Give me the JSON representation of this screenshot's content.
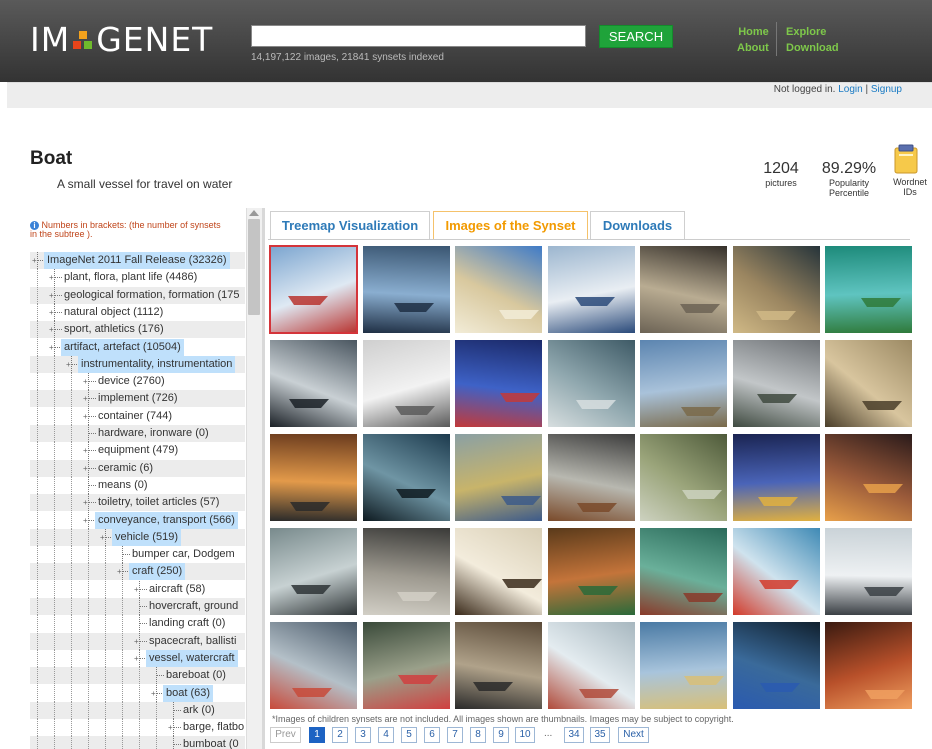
{
  "header": {
    "logo_text_left": "IM",
    "logo_text_right": "GENET",
    "search_button": "SEARCH",
    "index_info": "14,197,122 images, 21841 synsets indexed",
    "nav_left": [
      "Home",
      "About"
    ],
    "nav_right": [
      "Explore",
      "Download"
    ],
    "login_prefix": "Not logged in.",
    "login_link": "Login",
    "login_sep": "|",
    "signup_link": "Signup"
  },
  "synset": {
    "title": "Boat",
    "gloss": "A small vessel for travel on water",
    "pictures_count": "1204",
    "pictures_label": "pictures",
    "popularity_value": "89.29%",
    "popularity_label_1": "Popularity",
    "popularity_label_2": "Percentile",
    "wordnet_label_1": "Wordnet",
    "wordnet_label_2": "IDs"
  },
  "tree": {
    "note_line1": "Numbers in brackets: (the number of synsets",
    "note_line2": "in the subtree ).",
    "items": [
      {
        "label": "ImageNet 2011 Fall Release (32326)",
        "depth": 0,
        "selected": true,
        "expandable": true
      },
      {
        "label": "plant, flora, plant life (4486)",
        "depth": 1,
        "selected": false,
        "expandable": true
      },
      {
        "label": "geological formation, formation (175",
        "depth": 1,
        "selected": false,
        "expandable": true
      },
      {
        "label": "natural object (1112)",
        "depth": 1,
        "selected": false,
        "expandable": true
      },
      {
        "label": "sport, athletics (176)",
        "depth": 1,
        "selected": false,
        "expandable": true
      },
      {
        "label": "artifact, artefact (10504)",
        "depth": 1,
        "selected": true,
        "expandable": true
      },
      {
        "label": "instrumentality, instrumentation",
        "depth": 2,
        "selected": true,
        "expandable": true
      },
      {
        "label": "device (2760)",
        "depth": 3,
        "selected": false,
        "expandable": true
      },
      {
        "label": "implement (726)",
        "depth": 3,
        "selected": false,
        "expandable": true
      },
      {
        "label": "container (744)",
        "depth": 3,
        "selected": false,
        "expandable": true
      },
      {
        "label": "hardware, ironware (0)",
        "depth": 3,
        "selected": false,
        "expandable": false
      },
      {
        "label": "equipment (479)",
        "depth": 3,
        "selected": false,
        "expandable": true
      },
      {
        "label": "ceramic (6)",
        "depth": 3,
        "selected": false,
        "expandable": true
      },
      {
        "label": "means (0)",
        "depth": 3,
        "selected": false,
        "expandable": false
      },
      {
        "label": "toiletry, toilet articles (57)",
        "depth": 3,
        "selected": false,
        "expandable": true
      },
      {
        "label": "conveyance, transport (566)",
        "depth": 3,
        "selected": true,
        "expandable": true
      },
      {
        "label": "vehicle (519)",
        "depth": 4,
        "selected": true,
        "expandable": true
      },
      {
        "label": "bumper car, Dodgem",
        "depth": 5,
        "selected": false,
        "expandable": false
      },
      {
        "label": "craft (250)",
        "depth": 5,
        "selected": true,
        "expandable": true
      },
      {
        "label": "aircraft (58)",
        "depth": 6,
        "selected": false,
        "expandable": true
      },
      {
        "label": "hovercraft, ground",
        "depth": 6,
        "selected": false,
        "expandable": false
      },
      {
        "label": "landing craft (0)",
        "depth": 6,
        "selected": false,
        "expandable": false
      },
      {
        "label": "spacecraft, ballisti",
        "depth": 6,
        "selected": false,
        "expandable": true
      },
      {
        "label": "vessel, watercraft",
        "depth": 6,
        "selected": true,
        "expandable": true
      },
      {
        "label": "bareboat (0)",
        "depth": 7,
        "selected": false,
        "expandable": false
      },
      {
        "label": "boat (63)",
        "depth": 7,
        "selected": true,
        "expandable": true
      },
      {
        "label": "ark (0)",
        "depth": 8,
        "selected": false,
        "expandable": false
      },
      {
        "label": "barge, flatbo",
        "depth": 8,
        "selected": false,
        "expandable": true
      },
      {
        "label": "bumboat (0",
        "depth": 8,
        "selected": false,
        "expandable": false
      }
    ]
  },
  "tabs": [
    {
      "label": "Treemap Visualization",
      "active": false
    },
    {
      "label": "Images of the Synset",
      "active": true
    },
    {
      "label": "Downloads",
      "active": false
    }
  ],
  "images": {
    "count_shown": 35,
    "palettes": [
      [
        "#7aa4cf",
        "#dfe9f3",
        "#b8322e"
      ],
      [
        "#3a5672",
        "#8aaed0",
        "#1f2f44"
      ],
      [
        "#3f7bc7",
        "#d8c89e",
        "#f2ecd7"
      ],
      [
        "#9cb6cf",
        "#e9eef3",
        "#2a4a7a"
      ],
      [
        "#35302a",
        "#b9ac92",
        "#6c6355"
      ],
      [
        "#26343a",
        "#9a8560",
        "#d0b986"
      ],
      [
        "#1d8a7a",
        "#5fc4c0",
        "#2f7a3a"
      ],
      [
        "#4a5660",
        "#c9d0d4",
        "#1a2026"
      ],
      [
        "#cfcfcf",
        "#f2f2f2",
        "#5a5a5a"
      ],
      [
        "#1b2a6a",
        "#3e62c7",
        "#c23a3a"
      ],
      [
        "#3e5a66",
        "#8fa7ae",
        "#d7dedf"
      ],
      [
        "#5c85b0",
        "#a9c2da",
        "#7a6a4a"
      ],
      [
        "#6e7276",
        "#c2c6c8",
        "#3f4a40"
      ],
      [
        "#9c8a64",
        "#d8c59e",
        "#4a3e2a"
      ],
      [
        "#6a3b1e",
        "#e39a4a",
        "#2a2a2a"
      ],
      [
        "#1d3b4e",
        "#6f95a4",
        "#0e1a20"
      ],
      [
        "#8aa0a4",
        "#c8b46a",
        "#3c5a8a"
      ],
      [
        "#3c3c3c",
        "#b8b8b0",
        "#7a4a2a"
      ],
      [
        "#4e5a3a",
        "#9aa47a",
        "#cdd2c0"
      ],
      [
        "#1a2452",
        "#4a64b8",
        "#e0b040"
      ],
      [
        "#2a1a1a",
        "#9a5a3a",
        "#e8a04a"
      ],
      [
        "#788a8c",
        "#c7d1d2",
        "#2e3436"
      ],
      [
        "#3a3a38",
        "#9e9a90",
        "#d2cfc6"
      ],
      [
        "#d9cfb6",
        "#f3ecdc",
        "#3a2a1a"
      ],
      [
        "#5a3a1a",
        "#c4743a",
        "#2a6a3a"
      ],
      [
        "#2a6a5a",
        "#6ab09a",
        "#8a3a2a"
      ],
      [
        "#3f8ab5",
        "#cfe3ee",
        "#d23a2a"
      ],
      [
        "#c9d2d7",
        "#eef1f3",
        "#3a3f44"
      ],
      [
        "#4a5a6a",
        "#b4c0c8",
        "#c84a3a"
      ],
      [
        "#3a4a3a",
        "#9aa08a",
        "#d04040"
      ],
      [
        "#5a4a38",
        "#b0a28a",
        "#2a2a2a"
      ],
      [
        "#a7b7bf",
        "#e4ecf0",
        "#b04a3a"
      ],
      [
        "#4a7aa4",
        "#a8c4dc",
        "#d8c078"
      ],
      [
        "#10202e",
        "#3a6a9a",
        "#2a5ab0"
      ],
      [
        "#3a1a10",
        "#b8502a",
        "#f0a060"
      ]
    ]
  },
  "footer": {
    "copyright": "*Images of children synsets are not included. All images shown are thumbnails. Images may be subject to copyright.",
    "prev": "Prev",
    "next": "Next",
    "pages": [
      "1",
      "2",
      "3",
      "4",
      "5",
      "6",
      "7",
      "8",
      "9",
      "10"
    ],
    "ellipsis": "...",
    "tail_pages": [
      "34",
      "35"
    ],
    "current_page": "1"
  },
  "colors": {
    "accent_green": "#1fa33a",
    "link_blue": "#2e7ab8",
    "active_tab": "#f29a00",
    "selected_tree_bg": "#bfe0fb"
  }
}
